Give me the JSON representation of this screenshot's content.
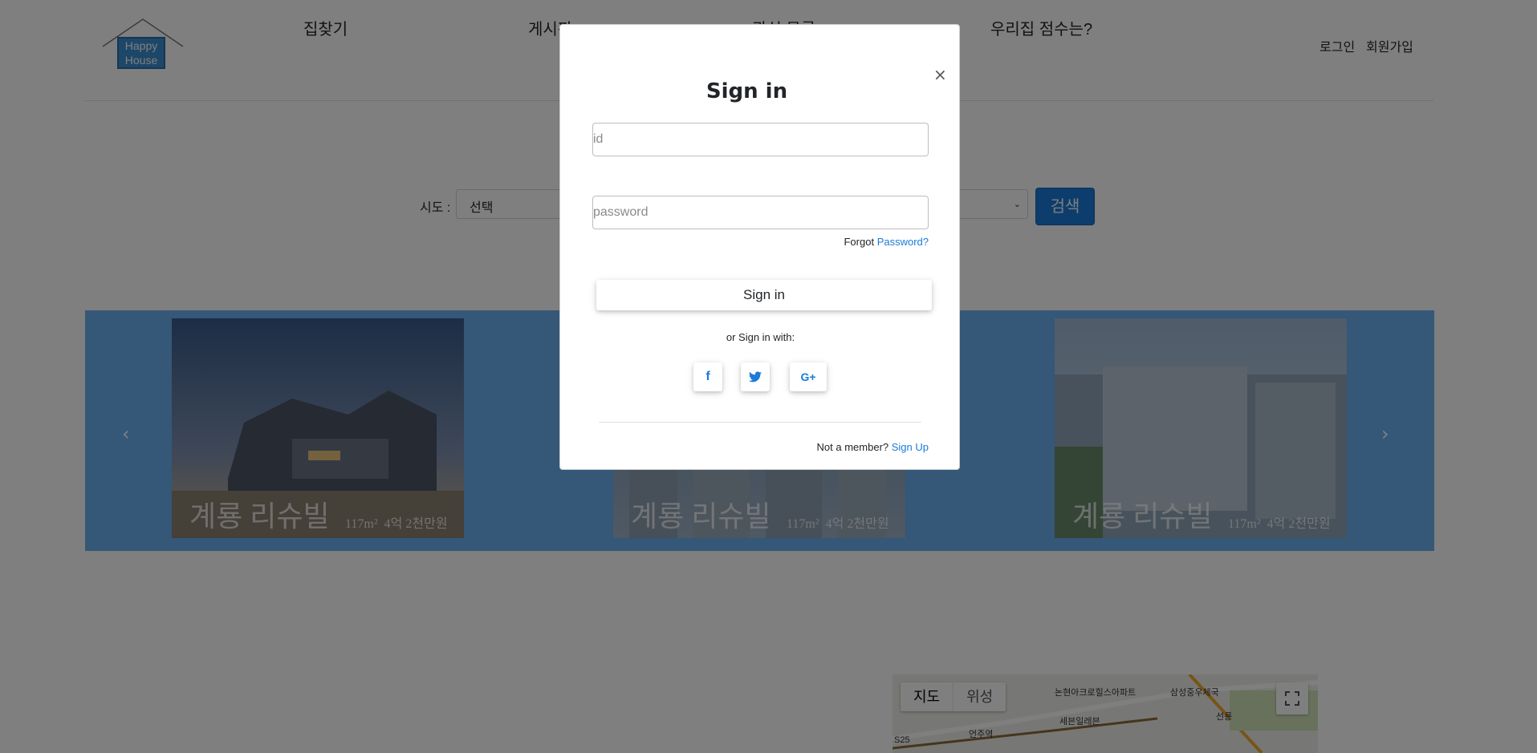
{
  "header": {
    "logo_line1": "Happy",
    "logo_line2": "House",
    "nav": [
      "집찾기",
      "게시판",
      "관심 목록",
      "우리집 점수는?"
    ],
    "login": "로그인",
    "signup": "회원가입"
  },
  "search": {
    "label": "시도 :",
    "select_value": "선택",
    "button": "검색"
  },
  "carousel": {
    "slides": [
      {
        "title": "계룡 리슈빌",
        "area": "117m²",
        "price": "4억 2천만원"
      },
      {
        "title": "계룡 리슈빌",
        "area": "117m²",
        "price": "4억 2천만원"
      },
      {
        "title": "계룡 리슈빌",
        "area": "117m²",
        "price": "4억 2천만원"
      }
    ]
  },
  "map": {
    "tab_map": "지도",
    "tab_satellite": "위성",
    "labels": [
      "논현아크로힐스아파트",
      "삼성중우체국",
      "세븐일레븐",
      "언주역",
      "선릉",
      "S25"
    ]
  },
  "modal": {
    "title": "Sign in",
    "close": "×",
    "id_placeholder": "id",
    "password_placeholder": "password",
    "forgot_prefix": "Forgot",
    "forgot_link": "Password?",
    "signin_button": "Sign in",
    "or_text": "or Sign in with:",
    "social": [
      "f",
      "t",
      "G+"
    ],
    "not_member": "Not a member?",
    "signup_link": "Sign Up"
  },
  "colors": {
    "accent": "#1b7bd8",
    "carousel_bg": "#6aaef0",
    "overlay": "rgba(0,0,0,0.5)"
  }
}
